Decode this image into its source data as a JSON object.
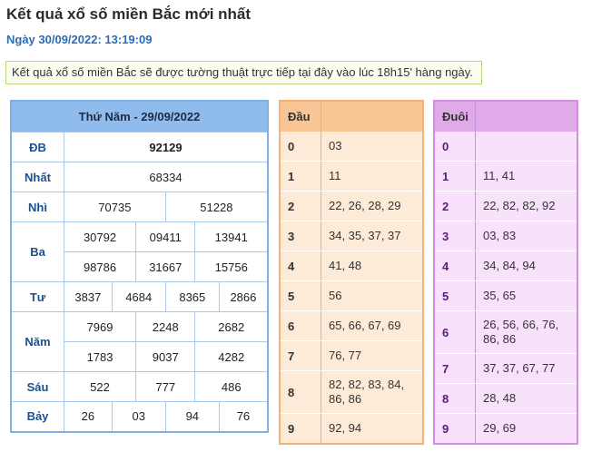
{
  "page": {
    "title": "Kết quả xổ số miền Bắc mới nhất",
    "date": "Ngày 30/09/2022: 13:19:09",
    "notice": "Kết quả xổ số miền Bắc sẽ được tường thuật trực tiếp tại đây vào lúc 18h15' hàng ngày."
  },
  "result": {
    "header": "Thứ Năm - 29/09/2022",
    "prizes": {
      "db": {
        "label": "ĐB",
        "values": [
          "92129"
        ]
      },
      "nhat": {
        "label": "Nhất",
        "values": [
          "68334"
        ]
      },
      "nhi": {
        "label": "Nhì",
        "values": [
          "70735",
          "51228"
        ]
      },
      "ba": {
        "label": "Ba",
        "values": [
          "30792",
          "09411",
          "13941",
          "98786",
          "31667",
          "15756"
        ]
      },
      "tu": {
        "label": "Tư",
        "values": [
          "3837",
          "4684",
          "8365",
          "2866"
        ]
      },
      "nam": {
        "label": "Năm",
        "values": [
          "7969",
          "2248",
          "2682",
          "1783",
          "9037",
          "4282"
        ]
      },
      "sau": {
        "label": "Sáu",
        "values": [
          "522",
          "777",
          "486"
        ]
      },
      "bay": {
        "label": "Bảy",
        "values": [
          "26",
          "03",
          "94",
          "76"
        ]
      }
    }
  },
  "dau": {
    "header": "Đầu",
    "rows": [
      {
        "key": "0",
        "value": "03"
      },
      {
        "key": "1",
        "value": "11"
      },
      {
        "key": "2",
        "value": "22, 26, 28, 29"
      },
      {
        "key": "3",
        "value": "34, 35, 37, 37"
      },
      {
        "key": "4",
        "value": "41, 48"
      },
      {
        "key": "5",
        "value": "56"
      },
      {
        "key": "6",
        "value": "65, 66, 67, 69"
      },
      {
        "key": "7",
        "value": "76, 77"
      },
      {
        "key": "8",
        "value": "82, 82, 83, 84, 86, 86"
      },
      {
        "key": "9",
        "value": "92, 94"
      }
    ]
  },
  "duoi": {
    "header": "Đuôi",
    "rows": [
      {
        "key": "0",
        "value": ""
      },
      {
        "key": "1",
        "value": "11, 41"
      },
      {
        "key": "2",
        "value": "22, 82, 82, 92"
      },
      {
        "key": "3",
        "value": "03, 83"
      },
      {
        "key": "4",
        "value": "34, 84, 94"
      },
      {
        "key": "5",
        "value": "35, 65"
      },
      {
        "key": "6",
        "value": "26, 56, 66, 76, 86, 86"
      },
      {
        "key": "7",
        "value": "37, 37, 67, 77"
      },
      {
        "key": "8",
        "value": "28, 48"
      },
      {
        "key": "9",
        "value": "29, 69"
      }
    ]
  }
}
